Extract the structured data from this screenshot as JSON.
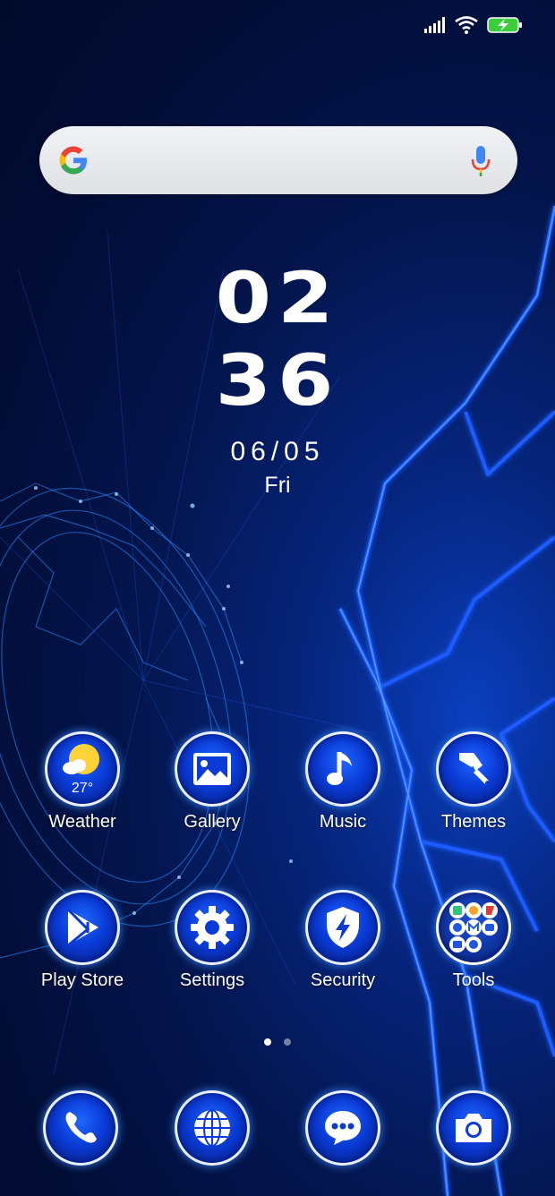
{
  "status_bar": {
    "signal": "signal-icon",
    "wifi": "wifi-icon",
    "battery": "battery-charging-icon"
  },
  "search": {
    "logo": "google-logo",
    "voice": "mic-icon"
  },
  "clock": {
    "hour": "02",
    "minute": "36",
    "date": "06/05",
    "day": "Fri"
  },
  "apps": [
    {
      "label": "Weather",
      "icon": "weather-icon",
      "temp": "27°"
    },
    {
      "label": "Gallery",
      "icon": "gallery-icon"
    },
    {
      "label": "Music",
      "icon": "music-note-icon"
    },
    {
      "label": "Themes",
      "icon": "paintbrush-icon"
    },
    {
      "label": "Play Store",
      "icon": "play-store-icon"
    },
    {
      "label": "Settings",
      "icon": "gear-icon"
    },
    {
      "label": "Security",
      "icon": "shield-bolt-icon"
    },
    {
      "label": "Tools",
      "icon": "folder-icon"
    }
  ],
  "page_indicator": {
    "total": 2,
    "active": 1
  },
  "dock": [
    {
      "icon": "phone-icon"
    },
    {
      "icon": "browser-globe-icon"
    },
    {
      "icon": "messages-icon"
    },
    {
      "icon": "camera-icon"
    }
  ]
}
